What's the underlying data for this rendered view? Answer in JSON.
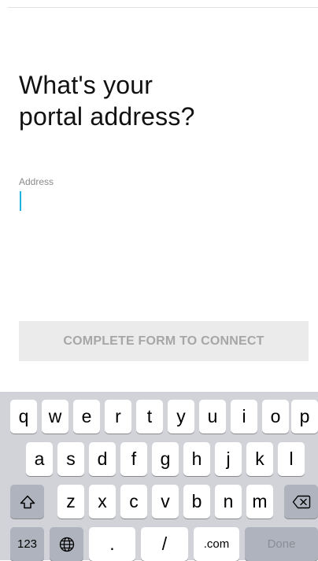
{
  "form": {
    "title": "What's your\nportal address?",
    "address": {
      "label": "Address",
      "value": "",
      "placeholder": ""
    },
    "connect_button_label": "COMPLETE FORM TO CONNECT"
  },
  "keyboard": {
    "row1": [
      "q",
      "w",
      "e",
      "r",
      "t",
      "y",
      "u",
      "i",
      "o",
      "p"
    ],
    "row2": [
      "a",
      "s",
      "d",
      "f",
      "g",
      "h",
      "j",
      "k",
      "l"
    ],
    "row3": [
      "z",
      "x",
      "c",
      "v",
      "b",
      "n",
      "m"
    ],
    "numbers_label": "123",
    "period_label": ".",
    "slash_label": "/",
    "dotcom_label": ".com",
    "done_label": "Done",
    "icons": {
      "shift": "shift-icon",
      "backspace": "backspace-icon",
      "globe": "globe-icon"
    }
  }
}
